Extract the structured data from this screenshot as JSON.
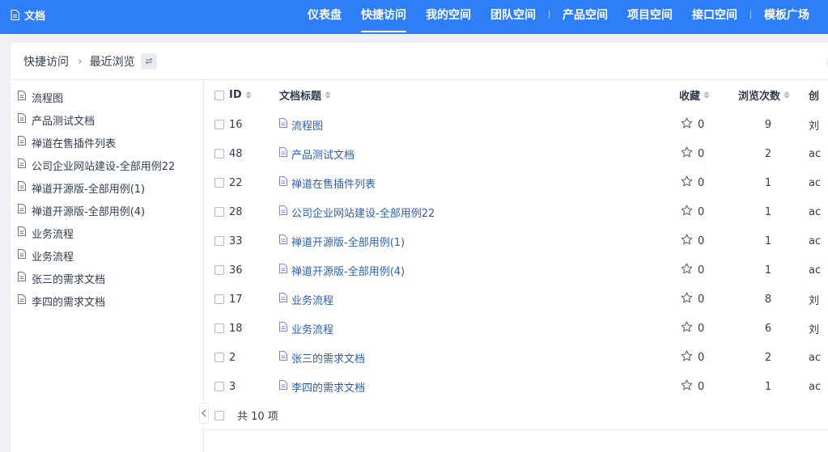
{
  "header": {
    "brand": "文档",
    "nav": [
      {
        "label": "仪表盘",
        "active": false,
        "sep_after": false
      },
      {
        "label": "快捷访问",
        "active": true,
        "sep_after": false
      },
      {
        "label": "我的空间",
        "active": false,
        "sep_after": false
      },
      {
        "label": "团队空间",
        "active": false,
        "sep_after": true
      },
      {
        "label": "产品空间",
        "active": false,
        "sep_after": false
      },
      {
        "label": "项目空间",
        "active": false,
        "sep_after": false
      },
      {
        "label": "接口空间",
        "active": false,
        "sep_after": true
      },
      {
        "label": "模板广场",
        "active": false,
        "sep_after": false
      }
    ]
  },
  "breadcrumb": {
    "root": "快捷访问",
    "current": "最近浏览"
  },
  "sidebar": {
    "items": [
      "流程图",
      "产品测试文档",
      "禅道在售插件列表",
      "公司企业网站建设-全部用例22",
      "禅道开源版-全部用例(1)",
      "禅道开源版-全部用例(4)",
      "业务流程",
      "业务流程",
      "张三的需求文档",
      "李四的需求文档"
    ]
  },
  "table": {
    "columns": {
      "id": "ID",
      "title": "文档标题",
      "collect": "收藏",
      "views": "浏览次数",
      "creator": "创"
    },
    "rows": [
      {
        "id": "16",
        "title": "流程图",
        "stars": "0",
        "views": "9",
        "creator": "刘"
      },
      {
        "id": "48",
        "title": "产品测试文档",
        "stars": "0",
        "views": "2",
        "creator": "ac"
      },
      {
        "id": "22",
        "title": "禅道在售插件列表",
        "stars": "0",
        "views": "1",
        "creator": "ac"
      },
      {
        "id": "28",
        "title": "公司企业网站建设-全部用例22",
        "stars": "0",
        "views": "1",
        "creator": "ac"
      },
      {
        "id": "33",
        "title": "禅道开源版-全部用例(1)",
        "stars": "0",
        "views": "1",
        "creator": "ac"
      },
      {
        "id": "36",
        "title": "禅道开源版-全部用例(4)",
        "stars": "0",
        "views": "1",
        "creator": "ac"
      },
      {
        "id": "17",
        "title": "业务流程",
        "stars": "0",
        "views": "8",
        "creator": "刘"
      },
      {
        "id": "18",
        "title": "业务流程",
        "stars": "0",
        "views": "6",
        "creator": "刘"
      },
      {
        "id": "2",
        "title": "张三的需求文档",
        "stars": "0",
        "views": "2",
        "creator": "ac"
      },
      {
        "id": "3",
        "title": "李四的需求文档",
        "stars": "0",
        "views": "1",
        "creator": "ac"
      }
    ],
    "footer": "共 10 项"
  },
  "colors": {
    "header_bg": "#2e7ef5",
    "link": "#2f5ea8",
    "text": "#313c52"
  },
  "icons": {
    "brand": "document-icon",
    "doc": "document-icon",
    "swap": "swap-icon",
    "star": "star-outline-icon",
    "sort": "sort-icon",
    "collapse": "chevron-left-icon"
  }
}
